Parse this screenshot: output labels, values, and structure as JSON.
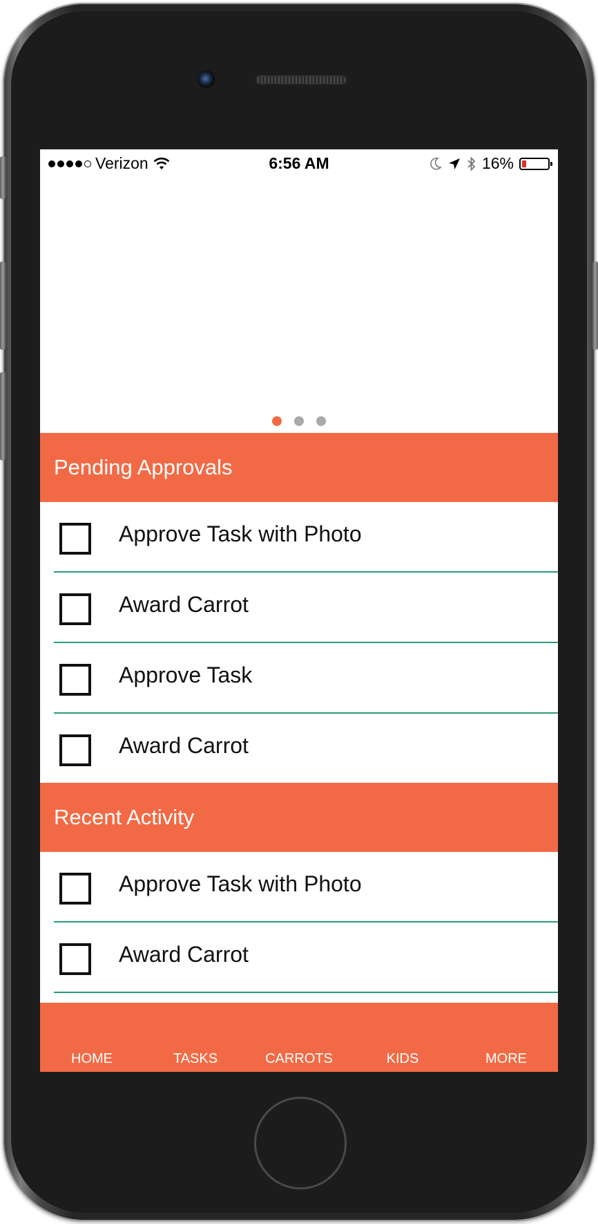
{
  "status_bar": {
    "carrier": "Verizon",
    "time": "6:56 AM",
    "battery_percent_text": "16%",
    "battery_level": 0.16,
    "signal_bars_filled": 4,
    "signal_bars_total": 5,
    "icons": [
      "wifi-icon",
      "moon-icon",
      "location-arrow-icon",
      "bluetooth-icon",
      "battery-icon"
    ]
  },
  "carousel": {
    "page_count": 3,
    "active_page": 1
  },
  "sections": {
    "pending": {
      "title": "Pending Approvals",
      "items": [
        {
          "label": "Approve Task with Photo"
        },
        {
          "label": "Award Carrot"
        },
        {
          "label": "Approve Task"
        },
        {
          "label": "Award Carrot"
        }
      ]
    },
    "recent": {
      "title": "Recent Activity",
      "items": [
        {
          "label": "Approve Task with Photo"
        },
        {
          "label": "Award Carrot"
        }
      ]
    }
  },
  "tab_bar": {
    "tabs": [
      {
        "label": "HOME"
      },
      {
        "label": "TASKS"
      },
      {
        "label": "CARROTS"
      },
      {
        "label": "KIDS"
      },
      {
        "label": "MORE"
      }
    ]
  },
  "colors": {
    "accent": "#f26a45",
    "divider": "#2a9d6e",
    "battery_low": "#e0302a"
  }
}
